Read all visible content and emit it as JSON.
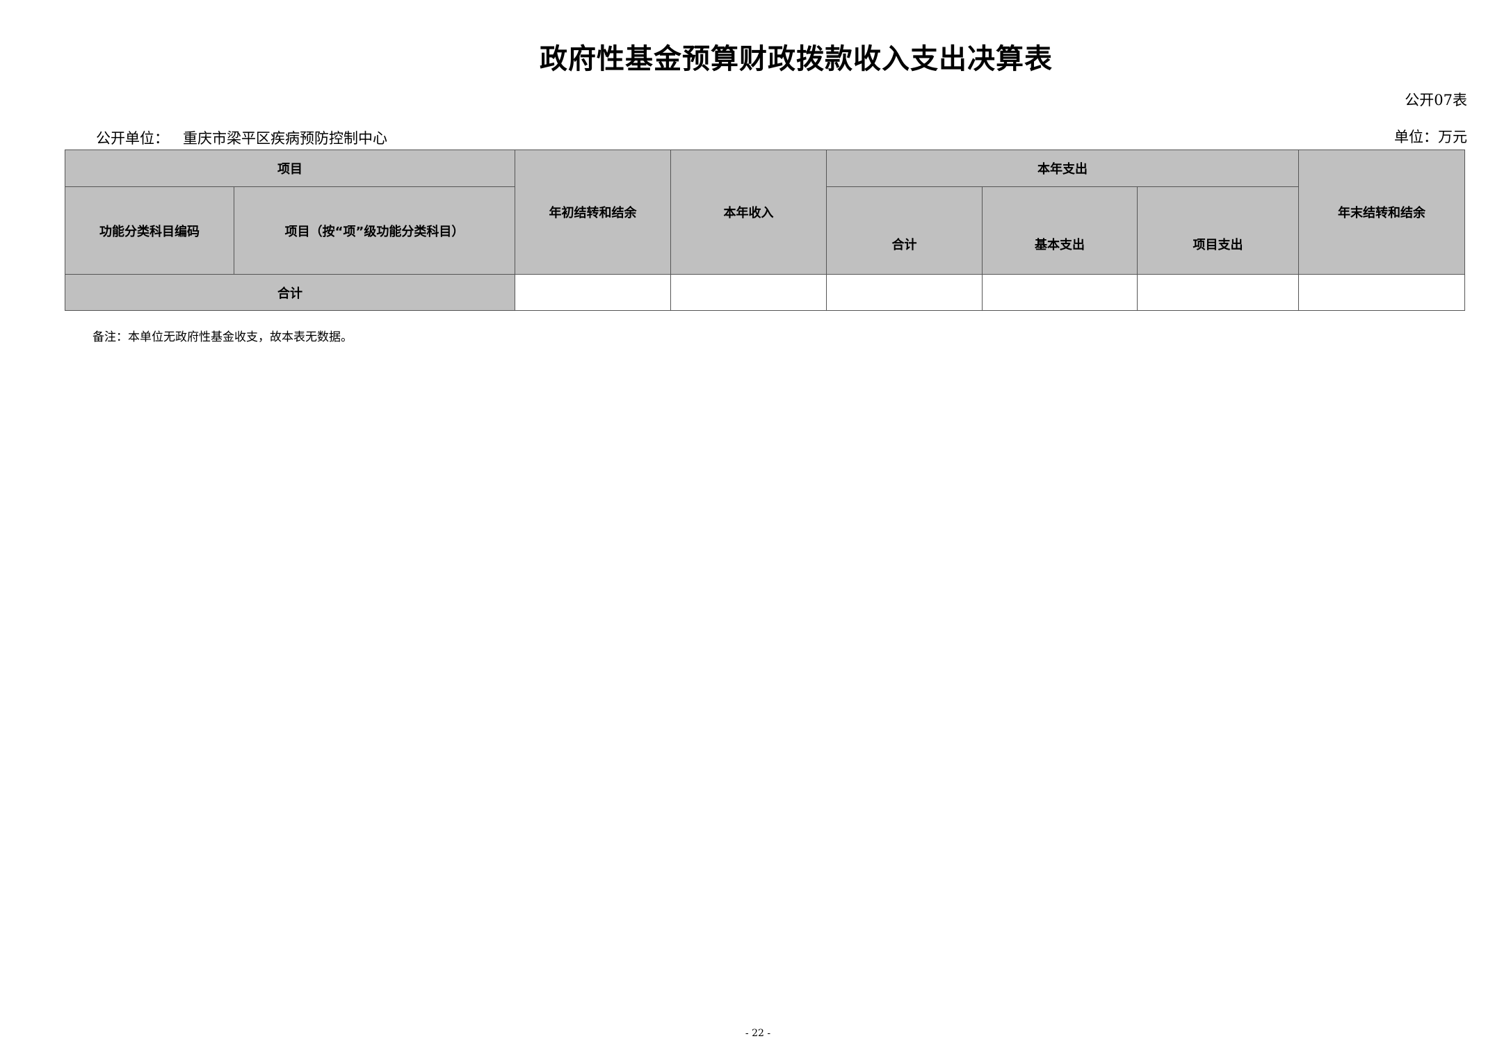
{
  "document": {
    "title": "政府性基金预算财政拨款收入支出决算表",
    "form_code": "公开07表",
    "unit_label": "公开单位：",
    "unit_name": "重庆市梁平区疾病预防控制中心",
    "measure": "单位：万元",
    "note": "备注：本单位无政府性基金收支，故本表无数据。",
    "page_number": "- 22 -"
  },
  "table": {
    "headers": {
      "project": "项目",
      "func_code": "功能分类科目编码",
      "func_item": "项目（按“项”级功能分类科目）",
      "begin_balance": "年初结转和结余",
      "year_income": "本年收入",
      "year_expense": "本年支出",
      "exp_total": "合计",
      "exp_basic": "基本支出",
      "exp_project": "项目支出",
      "end_balance": "年末结转和结余"
    },
    "total_row": {
      "label": "合计",
      "begin_balance": "",
      "year_income": "",
      "exp_total": "",
      "exp_basic": "",
      "exp_project": "",
      "end_balance": ""
    }
  }
}
